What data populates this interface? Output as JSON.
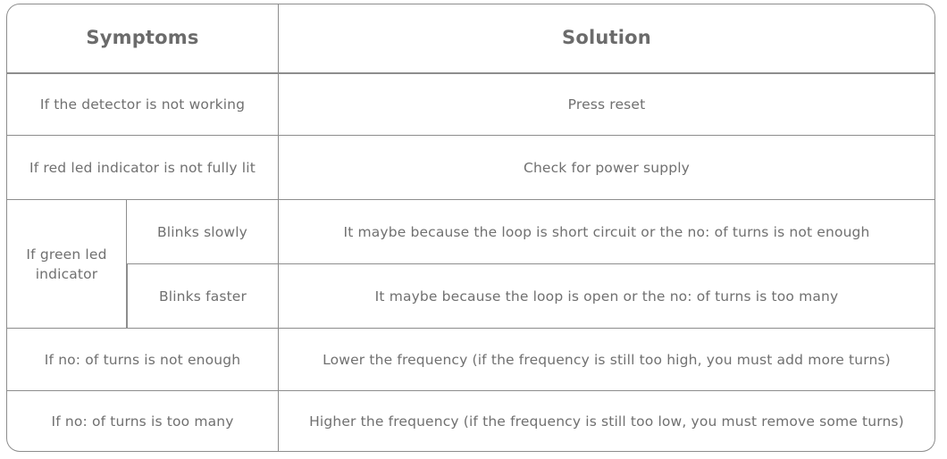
{
  "table": {
    "headers": {
      "symptoms": "Symptoms",
      "solution": "Solution"
    },
    "rows": [
      {
        "symptom": "If the detector is not working",
        "solution": "Press reset"
      },
      {
        "symptom": "If red led indicator is not fully lit",
        "solution": "Check for power supply"
      },
      {
        "symptom": "If green led indicator",
        "sub_symptom": "Blinks slowly",
        "solution": "It maybe because the loop is short circuit or the no: of turns is not enough"
      },
      {
        "sub_symptom": "Blinks faster",
        "solution": "It maybe because the loop is open or the no: of turns is too many"
      },
      {
        "symptom": "If no: of turns is not enough",
        "solution": "Lower the frequency (if the frequency is still too high, you must add more turns)"
      },
      {
        "symptom": "If no: of turns is too many",
        "solution": "Higher the frequency (if the frequency is still too low, you must remove some turns)"
      }
    ]
  },
  "style": {
    "border_color": "#8d8d8d",
    "text_color": "#707070",
    "header_text_color": "#6b6b6b",
    "background": "#ffffff"
  }
}
